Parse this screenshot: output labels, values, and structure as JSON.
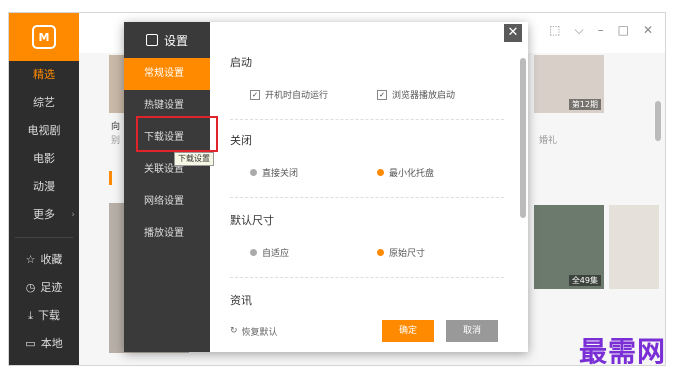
{
  "sidebar": {
    "logo": "M",
    "items": [
      {
        "label": "精选",
        "active": true
      },
      {
        "label": "综艺"
      },
      {
        "label": "电视剧"
      },
      {
        "label": "电影"
      },
      {
        "label": "动漫"
      },
      {
        "label": "更多",
        "arrow": "›"
      }
    ],
    "bottom": [
      {
        "icon": "☆",
        "label": "收藏"
      },
      {
        "icon": "◷",
        "label": "足迹"
      },
      {
        "icon": "⤓",
        "label": "下载"
      },
      {
        "icon": "▭",
        "label": "本地"
      }
    ]
  },
  "topbar": {
    "icons": [
      "⬚",
      "⌵",
      "–",
      "□",
      "✕"
    ]
  },
  "content": {
    "thumb1_label": "第12期",
    "thumb2_label": "全49集",
    "frag1": "向",
    "frag2": "别",
    "frag3": "婚礼"
  },
  "dialog": {
    "title": "设置",
    "nav": [
      "常规设置",
      "热键设置",
      "下载设置",
      "关联设置",
      "网络设置",
      "播放设置"
    ],
    "active_nav": "常规设置",
    "tooltip": "下载设置",
    "close": "✕",
    "sections": {
      "startup": {
        "title": "启动",
        "opt1": "开机时自动运行",
        "opt2": "浏览器播放启动"
      },
      "close": {
        "title": "关闭",
        "opt1": "直接关闭",
        "opt2": "最小化托盘"
      },
      "size": {
        "title": "默认尺寸",
        "opt1": "自适应",
        "opt2": "原始尺寸"
      },
      "news": {
        "title": "资讯"
      }
    },
    "restore": "恢复默认",
    "ok": "确定",
    "cancel": "取消"
  },
  "watermark": "最需网"
}
